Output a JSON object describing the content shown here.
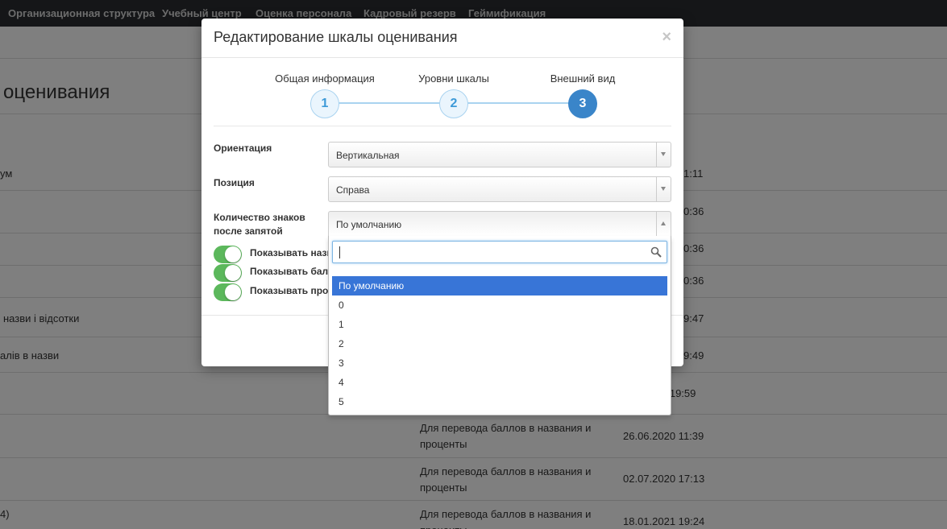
{
  "topnav": {
    "items": [
      "Организационная структура",
      "Учебный центр",
      "Оценка персонала",
      "Кадровый резерв",
      "Геймификация"
    ]
  },
  "background": {
    "title": "оценивания",
    "rows": [
      {
        "name": "ум",
        "time": "1:11"
      },
      {
        "name": "",
        "time": "0:36"
      },
      {
        "name": "",
        "time": "0:36"
      },
      {
        "name": "",
        "time": "0:36"
      },
      {
        "name": "назви і відсотки",
        "time": "9:47"
      },
      {
        "name": "алів в назви",
        "time": "9:49"
      },
      {
        "name": "",
        "time": "0 19:59"
      },
      {
        "name": "",
        "description": "Для перевода баллов в названия и проценты",
        "time": "26.06.2020 11:39"
      },
      {
        "name": "",
        "description": "Для перевода баллов в названия и проценты",
        "time": "02.07.2020 17:13"
      },
      {
        "name": "4)",
        "description": "Для перевода баллов в названия и проценты",
        "time": "18.01.2021 19:24"
      }
    ]
  },
  "modal": {
    "title": "Редактирование шкалы оценивания",
    "close": "×",
    "steps": [
      {
        "label": "Общая информация",
        "number": "1"
      },
      {
        "label": "Уровни шкалы",
        "number": "2"
      },
      {
        "label": "Внешний вид",
        "number": "3"
      }
    ],
    "active_step": 3,
    "fields": {
      "orientation": {
        "label": "Ориентация",
        "value": "Вертикальная"
      },
      "position": {
        "label": "Позиция",
        "value": "Справа"
      },
      "decimals": {
        "label": "Количество знаков после запятой",
        "value": "По умолчанию"
      }
    },
    "toggles": [
      {
        "label": "Показывать назв",
        "on": true
      },
      {
        "label": "Показывать балл",
        "on": true
      },
      {
        "label": "Показывать проц",
        "on": true
      }
    ]
  },
  "dropdown": {
    "search_value": "",
    "options": [
      "По умолчанию",
      "0",
      "1",
      "2",
      "3",
      "4",
      "5"
    ],
    "selected": "По умолчанию"
  },
  "colors": {
    "accent": "#3a85c9",
    "toggle_on": "#5cb85c",
    "selected_option": "#3875d7",
    "nav_bg": "#2a2d31"
  }
}
